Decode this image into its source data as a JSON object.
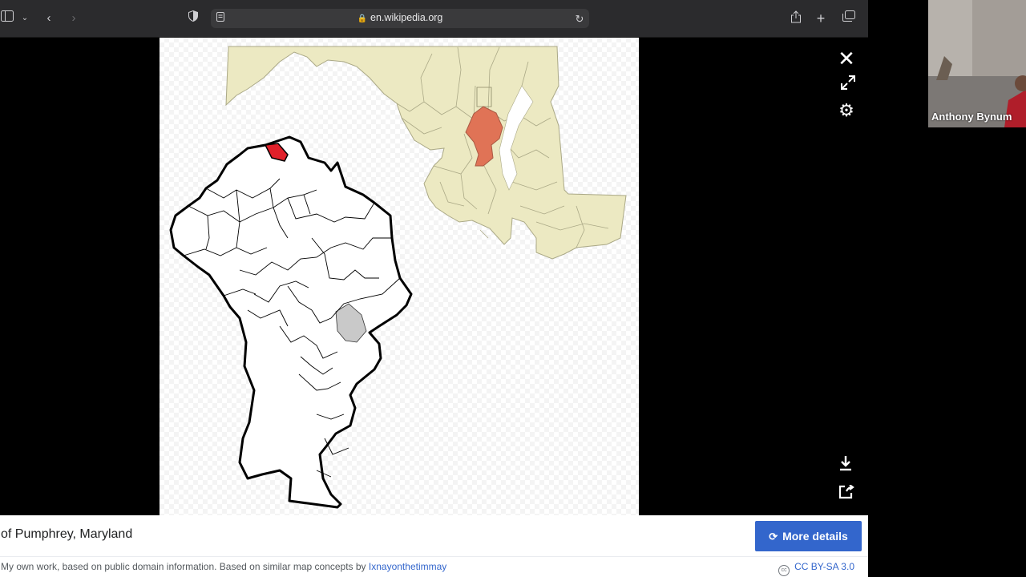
{
  "browser": {
    "url": "en.wikipedia.org"
  },
  "caption": {
    "title": "of Pumphrey, Maryland",
    "credit_text": "My own work, based on public domain information. Based on similar map concepts by",
    "credit_author": "Ixnayonthetimmay",
    "more_details_label": "More details",
    "license": "CC BY-SA 3.0"
  },
  "webcam": {
    "participant_name": "Anthony Bynum"
  },
  "colors": {
    "accent": "#3366cc",
    "state_fill": "#ece9c2",
    "county_highlight": "#e07356",
    "place_highlight": "#e0202a"
  }
}
